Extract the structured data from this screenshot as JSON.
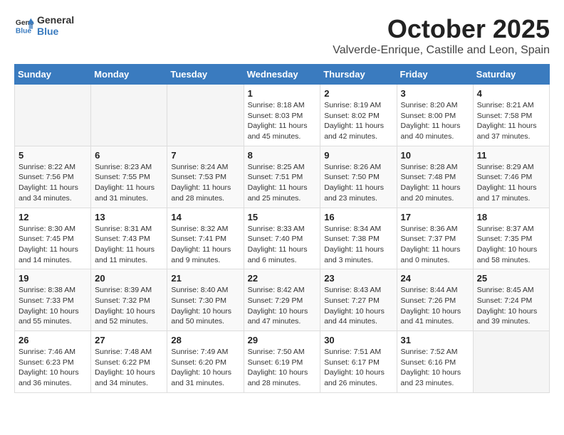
{
  "header": {
    "logo_line1": "General",
    "logo_line2": "Blue",
    "main_title": "October 2025",
    "sub_title": "Valverde-Enrique, Castille and Leon, Spain"
  },
  "weekdays": [
    "Sunday",
    "Monday",
    "Tuesday",
    "Wednesday",
    "Thursday",
    "Friday",
    "Saturday"
  ],
  "weeks": [
    [
      {
        "day": "",
        "info": ""
      },
      {
        "day": "",
        "info": ""
      },
      {
        "day": "",
        "info": ""
      },
      {
        "day": "1",
        "info": "Sunrise: 8:18 AM\nSunset: 8:03 PM\nDaylight: 11 hours\nand 45 minutes."
      },
      {
        "day": "2",
        "info": "Sunrise: 8:19 AM\nSunset: 8:02 PM\nDaylight: 11 hours\nand 42 minutes."
      },
      {
        "day": "3",
        "info": "Sunrise: 8:20 AM\nSunset: 8:00 PM\nDaylight: 11 hours\nand 40 minutes."
      },
      {
        "day": "4",
        "info": "Sunrise: 8:21 AM\nSunset: 7:58 PM\nDaylight: 11 hours\nand 37 minutes."
      }
    ],
    [
      {
        "day": "5",
        "info": "Sunrise: 8:22 AM\nSunset: 7:56 PM\nDaylight: 11 hours\nand 34 minutes."
      },
      {
        "day": "6",
        "info": "Sunrise: 8:23 AM\nSunset: 7:55 PM\nDaylight: 11 hours\nand 31 minutes."
      },
      {
        "day": "7",
        "info": "Sunrise: 8:24 AM\nSunset: 7:53 PM\nDaylight: 11 hours\nand 28 minutes."
      },
      {
        "day": "8",
        "info": "Sunrise: 8:25 AM\nSunset: 7:51 PM\nDaylight: 11 hours\nand 25 minutes."
      },
      {
        "day": "9",
        "info": "Sunrise: 8:26 AM\nSunset: 7:50 PM\nDaylight: 11 hours\nand 23 minutes."
      },
      {
        "day": "10",
        "info": "Sunrise: 8:28 AM\nSunset: 7:48 PM\nDaylight: 11 hours\nand 20 minutes."
      },
      {
        "day": "11",
        "info": "Sunrise: 8:29 AM\nSunset: 7:46 PM\nDaylight: 11 hours\nand 17 minutes."
      }
    ],
    [
      {
        "day": "12",
        "info": "Sunrise: 8:30 AM\nSunset: 7:45 PM\nDaylight: 11 hours\nand 14 minutes."
      },
      {
        "day": "13",
        "info": "Sunrise: 8:31 AM\nSunset: 7:43 PM\nDaylight: 11 hours\nand 11 minutes."
      },
      {
        "day": "14",
        "info": "Sunrise: 8:32 AM\nSunset: 7:41 PM\nDaylight: 11 hours\nand 9 minutes."
      },
      {
        "day": "15",
        "info": "Sunrise: 8:33 AM\nSunset: 7:40 PM\nDaylight: 11 hours\nand 6 minutes."
      },
      {
        "day": "16",
        "info": "Sunrise: 8:34 AM\nSunset: 7:38 PM\nDaylight: 11 hours\nand 3 minutes."
      },
      {
        "day": "17",
        "info": "Sunrise: 8:36 AM\nSunset: 7:37 PM\nDaylight: 11 hours\nand 0 minutes."
      },
      {
        "day": "18",
        "info": "Sunrise: 8:37 AM\nSunset: 7:35 PM\nDaylight: 10 hours\nand 58 minutes."
      }
    ],
    [
      {
        "day": "19",
        "info": "Sunrise: 8:38 AM\nSunset: 7:33 PM\nDaylight: 10 hours\nand 55 minutes."
      },
      {
        "day": "20",
        "info": "Sunrise: 8:39 AM\nSunset: 7:32 PM\nDaylight: 10 hours\nand 52 minutes."
      },
      {
        "day": "21",
        "info": "Sunrise: 8:40 AM\nSunset: 7:30 PM\nDaylight: 10 hours\nand 50 minutes."
      },
      {
        "day": "22",
        "info": "Sunrise: 8:42 AM\nSunset: 7:29 PM\nDaylight: 10 hours\nand 47 minutes."
      },
      {
        "day": "23",
        "info": "Sunrise: 8:43 AM\nSunset: 7:27 PM\nDaylight: 10 hours\nand 44 minutes."
      },
      {
        "day": "24",
        "info": "Sunrise: 8:44 AM\nSunset: 7:26 PM\nDaylight: 10 hours\nand 41 minutes."
      },
      {
        "day": "25",
        "info": "Sunrise: 8:45 AM\nSunset: 7:24 PM\nDaylight: 10 hours\nand 39 minutes."
      }
    ],
    [
      {
        "day": "26",
        "info": "Sunrise: 7:46 AM\nSunset: 6:23 PM\nDaylight: 10 hours\nand 36 minutes."
      },
      {
        "day": "27",
        "info": "Sunrise: 7:48 AM\nSunset: 6:22 PM\nDaylight: 10 hours\nand 34 minutes."
      },
      {
        "day": "28",
        "info": "Sunrise: 7:49 AM\nSunset: 6:20 PM\nDaylight: 10 hours\nand 31 minutes."
      },
      {
        "day": "29",
        "info": "Sunrise: 7:50 AM\nSunset: 6:19 PM\nDaylight: 10 hours\nand 28 minutes."
      },
      {
        "day": "30",
        "info": "Sunrise: 7:51 AM\nSunset: 6:17 PM\nDaylight: 10 hours\nand 26 minutes."
      },
      {
        "day": "31",
        "info": "Sunrise: 7:52 AM\nSunset: 6:16 PM\nDaylight: 10 hours\nand 23 minutes."
      },
      {
        "day": "",
        "info": ""
      }
    ]
  ]
}
